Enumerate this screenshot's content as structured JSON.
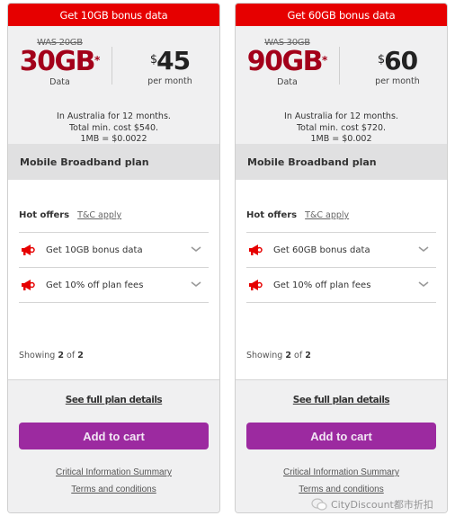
{
  "colors": {
    "banner": "#e60000",
    "data_amount": "#a3001a",
    "cart_button": "#9c2aa0",
    "icon_red": "#e60000"
  },
  "plans": [
    {
      "banner": "Get 10GB bonus data",
      "was": "WAS 20GB",
      "data": "30GB",
      "data_mark": "*",
      "data_label": "Data",
      "currency": "$",
      "price": "45",
      "price_label": "per month",
      "fine_print": [
        "In Australia for 12 months.",
        "Total min. cost $540.",
        "1MB = $0.0022"
      ],
      "plan_name": "Mobile Broadband plan",
      "hot_offers_label": "Hot offers",
      "tc_label": "T&C apply",
      "offers": [
        {
          "icon": "megaphone-icon",
          "text": "Get 10GB bonus data"
        },
        {
          "icon": "megaphone-icon",
          "text": "Get 10% off plan fees"
        }
      ],
      "showing_prefix": "Showing",
      "showing_current": "2",
      "showing_of": "of",
      "showing_total": "2",
      "full_details": "See full plan details",
      "cart_label": "Add to cart",
      "cis_link": "Critical Information Summary",
      "terms_link": "Terms and conditions"
    },
    {
      "banner": "Get 60GB bonus data",
      "was": "WAS 30GB",
      "data": "90GB",
      "data_mark": "*",
      "data_label": "Data",
      "currency": "$",
      "price": "60",
      "price_label": "per month",
      "fine_print": [
        "In Australia for 12 months.",
        "Total min. cost $720.",
        "1MB = $0.002"
      ],
      "plan_name": "Mobile Broadband plan",
      "hot_offers_label": "Hot offers",
      "tc_label": "T&C apply",
      "offers": [
        {
          "icon": "megaphone-icon",
          "text": "Get 60GB bonus data"
        },
        {
          "icon": "megaphone-icon",
          "text": "Get 10% off plan fees"
        }
      ],
      "showing_prefix": "Showing",
      "showing_current": "2",
      "showing_of": "of",
      "showing_total": "2",
      "full_details": "See full plan details",
      "cart_label": "Add to cart",
      "cis_link": "Critical Information Summary",
      "terms_link": "Terms and conditions"
    }
  ],
  "watermark": {
    "icon": "wechat-icon",
    "text": "CityDiscount都市折扣"
  }
}
